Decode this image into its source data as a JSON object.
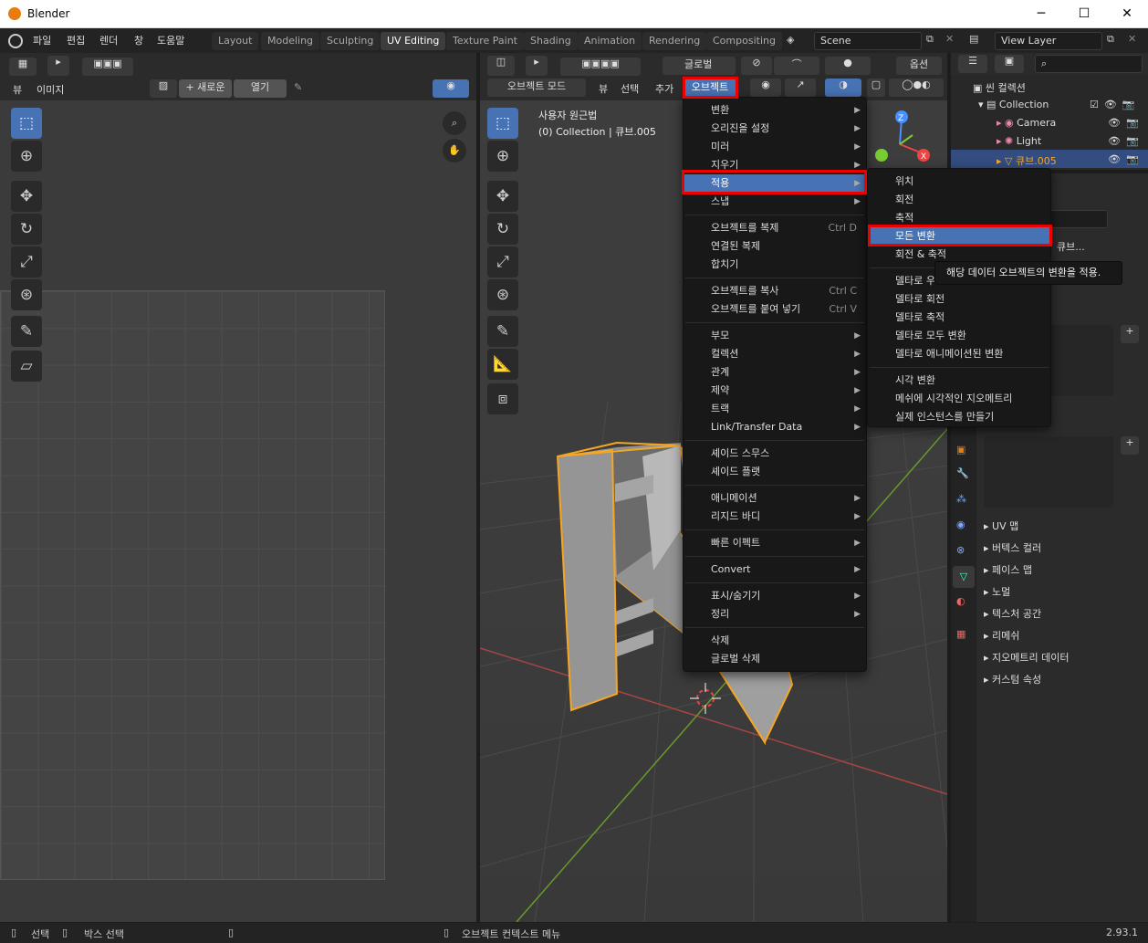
{
  "window": {
    "title": "Blender",
    "minimize": "─",
    "maximize": "☐",
    "close": "✕"
  },
  "menubar": [
    "파일",
    "편집",
    "렌더",
    "창",
    "도움말"
  ],
  "workspaces": [
    "Layout",
    "Modeling",
    "Sculpting",
    "UV Editing",
    "Texture Paint",
    "Shading",
    "Animation",
    "Rendering",
    "Compositing"
  ],
  "active_workspace": "UV Editing",
  "scene": "Scene",
  "view_layer": "View Layer",
  "uv_editor": {
    "menus": [
      "뷰",
      "이미지"
    ],
    "new_btn": "+ 새로운",
    "open_btn": "열기"
  },
  "viewport": {
    "mode": "오브젝트 모드",
    "menus": [
      "뷰",
      "선택",
      "추가",
      "오브젝트"
    ],
    "orientation": "글로벌",
    "options": "옵션",
    "overlay_title": "사용자 원근법",
    "overlay_sub": "(0) Collection | 큐브.005"
  },
  "object_menu": {
    "items": [
      {
        "label": "변환",
        "sub": true
      },
      {
        "label": "오리진을 설정",
        "sub": true
      },
      {
        "label": "미러",
        "sub": true
      },
      {
        "label": "지우기",
        "sub": true
      },
      {
        "label": "적용",
        "sub": true,
        "highlight": true
      },
      {
        "label": "스냅",
        "sub": true
      },
      {
        "sep": true
      },
      {
        "label": "오브젝트를 복제",
        "shortcut": "Ctrl D"
      },
      {
        "label": "연결된 복제"
      },
      {
        "label": "합치기"
      },
      {
        "sep": true
      },
      {
        "label": "오브젝트를 복사",
        "shortcut": "Ctrl C"
      },
      {
        "label": "오브젝트를 붙여 넣기",
        "shortcut": "Ctrl V"
      },
      {
        "sep": true
      },
      {
        "label": "부모",
        "sub": true
      },
      {
        "label": "컬렉션",
        "sub": true
      },
      {
        "label": "관계",
        "sub": true
      },
      {
        "label": "제약",
        "sub": true
      },
      {
        "label": "트랙",
        "sub": true
      },
      {
        "label": "Link/Transfer Data",
        "sub": true
      },
      {
        "sep": true
      },
      {
        "label": "셰이드 스무스"
      },
      {
        "label": "셰이드 플랫"
      },
      {
        "sep": true
      },
      {
        "label": "애니메이션",
        "sub": true
      },
      {
        "label": "리지드 바디",
        "sub": true
      },
      {
        "sep": true
      },
      {
        "label": "빠른 이펙트",
        "sub": true
      },
      {
        "sep": true
      },
      {
        "label": "Convert",
        "sub": true
      },
      {
        "sep": true
      },
      {
        "label": "표시/숨기기",
        "sub": true
      },
      {
        "label": "정리",
        "sub": true
      },
      {
        "sep": true
      },
      {
        "label": "삭제"
      },
      {
        "label": "글로벌 삭제"
      }
    ]
  },
  "apply_menu": {
    "items": [
      {
        "label": "위치"
      },
      {
        "label": "회전"
      },
      {
        "label": "축적"
      },
      {
        "label": "모든 변환",
        "highlight": true
      },
      {
        "label": "회전 & 축적"
      },
      {
        "sep": true
      },
      {
        "label": "델타로 우"
      },
      {
        "label": "델타로 회전"
      },
      {
        "label": "델타로 축적"
      },
      {
        "label": "델타로 모두 변환"
      },
      {
        "label": "델타로 애니메이션된 변환"
      },
      {
        "sep": true
      },
      {
        "label": "시각 변환"
      },
      {
        "label": "메쉬에 시각적인 지오메트리"
      },
      {
        "label": "실제 인스턴스를 만들기"
      }
    ],
    "tooltip": "해당 데이터 오브젝트의 변환을 적용."
  },
  "outliner": {
    "scene_collection": "씬 컬렉션",
    "collection": "Collection",
    "items": [
      {
        "label": "Camera"
      },
      {
        "label": "Light"
      },
      {
        "label": "큐브.005",
        "selected": true
      }
    ]
  },
  "properties": {
    "mesh_name": "큐브...",
    "sections": [
      "UV 맵",
      "버텍스 컬러",
      "페이스 맵",
      "노멀",
      "텍스처 공간",
      "리메쉬",
      "지오메트리 데이터",
      "커스텀 속성"
    ]
  },
  "statusbar": {
    "select": "선택",
    "box_select": "박스 선택",
    "context": "오브젝트 컨텍스트 메뉴",
    "version": "2.93.1"
  },
  "colors": {
    "accent": "#4772b3",
    "highlight_box": "#e00000",
    "selection_orange": "#f5a623"
  }
}
